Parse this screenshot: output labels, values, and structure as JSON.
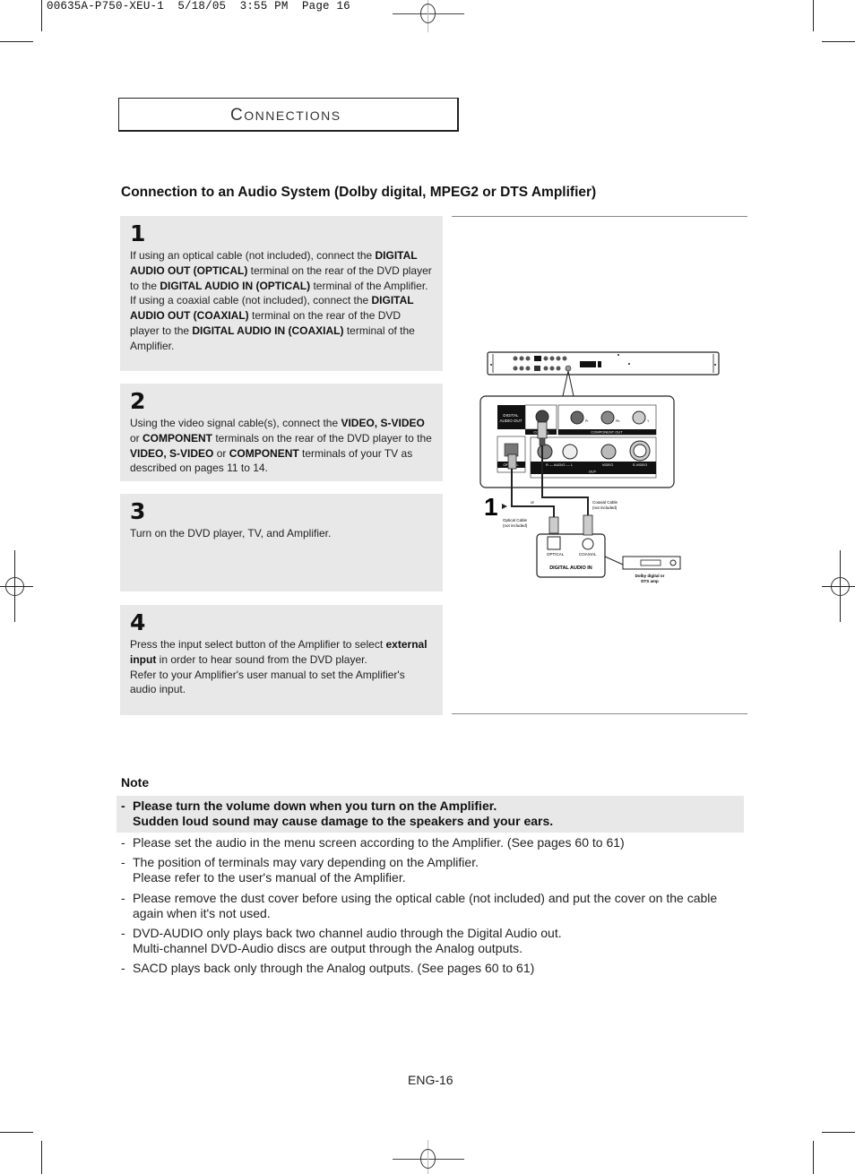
{
  "print_slug": "00635A-P750-XEU-1  5/18/05  3:55 PM  Page 16",
  "section": {
    "title_first": "C",
    "title_rest": "ONNECTIONS"
  },
  "heading": "Connection to an Audio System (Dolby digital, MPEG2 or DTS Amplifier)",
  "steps": [
    {
      "number": "1",
      "segments": [
        {
          "t": "If using an optical cable (not included), connect the ",
          "b": false
        },
        {
          "t": "DIGITAL AUDIO OUT (OPTICAL)",
          "b": true
        },
        {
          "t": " terminal on the rear of the DVD player to the ",
          "b": false
        },
        {
          "t": "DIGITAL AUDIO IN (OPTICAL)",
          "b": true
        },
        {
          "t": " terminal of the Amplifier.",
          "b": false
        },
        {
          "t": "\n",
          "b": false
        },
        {
          "t": "If using a coaxial cable (not included), connect the ",
          "b": false
        },
        {
          "t": "DIGITAL AUDIO OUT (COAXIAL)",
          "b": true
        },
        {
          "t": " terminal on the rear of the DVD player to the ",
          "b": false
        },
        {
          "t": "DIGITAL AUDIO IN (COAXIAL)",
          "b": true
        },
        {
          "t": " terminal of the Amplifier.",
          "b": false
        }
      ]
    },
    {
      "number": "2",
      "segments": [
        {
          "t": "Using the video signal cable(s), connect the ",
          "b": false
        },
        {
          "t": "VIDEO, S-VIDEO",
          "b": true
        },
        {
          "t": " or ",
          "b": false
        },
        {
          "t": "COMPONENT",
          "b": true
        },
        {
          "t": " terminals on the rear of the DVD player to the ",
          "b": false
        },
        {
          "t": "VIDEO, S-VIDEO",
          "b": true
        },
        {
          "t": " or ",
          "b": false
        },
        {
          "t": "COMPONENT",
          "b": true
        },
        {
          "t": " terminals of your TV as described on pages 11 to 14.",
          "b": false
        }
      ]
    },
    {
      "number": "3",
      "segments": [
        {
          "t": "Turn on the DVD player, TV, and Amplifier.",
          "b": false
        }
      ]
    },
    {
      "number": "4",
      "segments": [
        {
          "t": "Press the input select button of the Amplifier to select ",
          "b": false
        },
        {
          "t": "external input",
          "b": true
        },
        {
          "t": " in order to hear sound from the DVD player.",
          "b": false
        },
        {
          "t": "\n",
          "b": false
        },
        {
          "t": "Refer to your Amplifier's user manual to set the Amplifier's audio input.",
          "b": false
        }
      ]
    }
  ],
  "diagram": {
    "step_marker": "1",
    "digital_audio_out_label_1": "DIGITAL",
    "digital_audio_out_label_2": "AUDIO OUT",
    "coaxial_label": "COAXIAL",
    "optical_label": "OPTICAL",
    "component_out_label": "COMPONENT OUT",
    "pr_label": "Pr",
    "pb_label": "Pb",
    "y_label": "Y",
    "audio_label": "R — AUDIO — L",
    "video_label": "VIDEO",
    "svideo_label": "S-VIDEO",
    "out_label": "OUT",
    "or_label": "or",
    "optical_cable_1": "Optical Cable",
    "optical_cable_2": "(not included)",
    "coaxial_cable_1": "Coaxial Cable",
    "coaxial_cable_2": "(not included)",
    "amp_optical_label": "OPTICAL",
    "amp_coaxial_label": "COAXIAL",
    "digital_audio_in_label": "DIGITAL AUDIO IN",
    "amp_caption_1": "Dolby digital or",
    "amp_caption_2": "DTS amp"
  },
  "note": {
    "title": "Note",
    "items": [
      {
        "bold": true,
        "lines": [
          "Please turn the volume down when you turn on the Amplifier.",
          "Sudden loud sound may cause damage to the speakers and your ears."
        ]
      },
      {
        "bold": false,
        "lines": [
          "Please set the audio in the menu screen according to the Amplifier. (See pages 60 to 61)"
        ]
      },
      {
        "bold": false,
        "lines": [
          "The position of terminals may vary depending on the Amplifier.",
          "Please refer to the user's manual of the Amplifier."
        ]
      },
      {
        "bold": false,
        "lines": [
          "Please remove the dust cover before using the optical cable (not included) and put the cover on the cable again when it's not used."
        ]
      },
      {
        "bold": false,
        "lines": [
          "DVD-AUDIO only plays back two channel audio through the Digital Audio out.",
          "Multi-channel DVD-Audio discs are output through the Analog outputs."
        ]
      },
      {
        "bold": false,
        "lines": [
          "SACD plays back only through the Analog outputs. (See pages 60 to 61)"
        ]
      }
    ]
  },
  "page_number": "ENG-16"
}
